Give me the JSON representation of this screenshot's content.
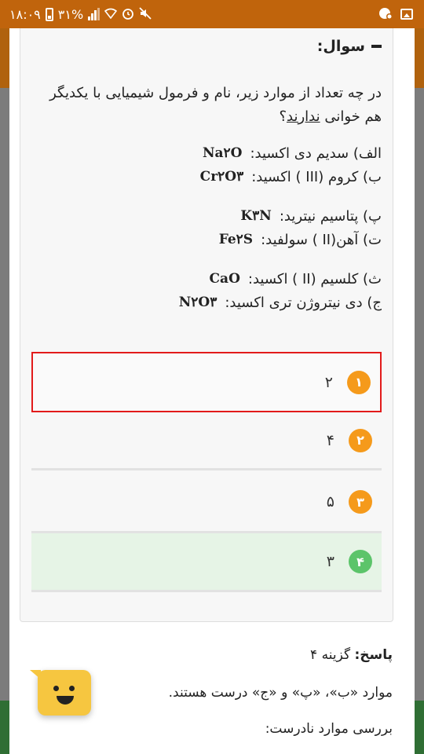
{
  "status_bar": {
    "time": "۱۸:۰۹",
    "battery": "۳۱%",
    "icons": [
      "battery-icon",
      "signal-icon",
      "wifi-icon",
      "alarm-icon",
      "mute-icon",
      "notification-icon",
      "image-icon"
    ]
  },
  "question": {
    "heading": "سوال:",
    "text_main": "در چه تعداد از موارد زیر، نام و فرمول شیمیایی با یکدیگر هم خوانی",
    "text_underlined": "ندارند",
    "text_end": "؟",
    "items": [
      {
        "label": "الف) سدیم دی اکسید:",
        "formula": "Na۲O"
      },
      {
        "label": "ب) کروم (III ) اکسید:",
        "formula": "Cr۲O۳"
      },
      {
        "label": "پ) پتاسیم نیترید:",
        "formula": "K۳N"
      },
      {
        "label": "ت) آهن(II ) سولفید:",
        "formula": "Fe۲S"
      },
      {
        "label": "ث) کلسیم (II ) اکسید:",
        "formula": "CaO"
      },
      {
        "label": "ج) دی نیتروژن تری اکسید:",
        "formula": "N۲O۳"
      }
    ]
  },
  "options": [
    {
      "number": "۱",
      "value": "۲",
      "state": "selected-wrong"
    },
    {
      "number": "۲",
      "value": "۴",
      "state": "normal"
    },
    {
      "number": "۳",
      "value": "۵",
      "state": "normal"
    },
    {
      "number": "۴",
      "value": "۳",
      "state": "correct"
    }
  ],
  "answer": {
    "label": "پاسخ:",
    "choice": "گزینه ۴",
    "line1": "موارد «ب»، «پ» و «ج» درست هستند.",
    "line2": "بررسی موارد نادرست:"
  },
  "colors": {
    "status_bar": "#c0640c",
    "option_badge": "#f59a1b",
    "correct_badge": "#5cc46a",
    "wrong_border": "#e21b1b",
    "correct_bg": "#e6f4e6",
    "bot": "#f6c640"
  }
}
